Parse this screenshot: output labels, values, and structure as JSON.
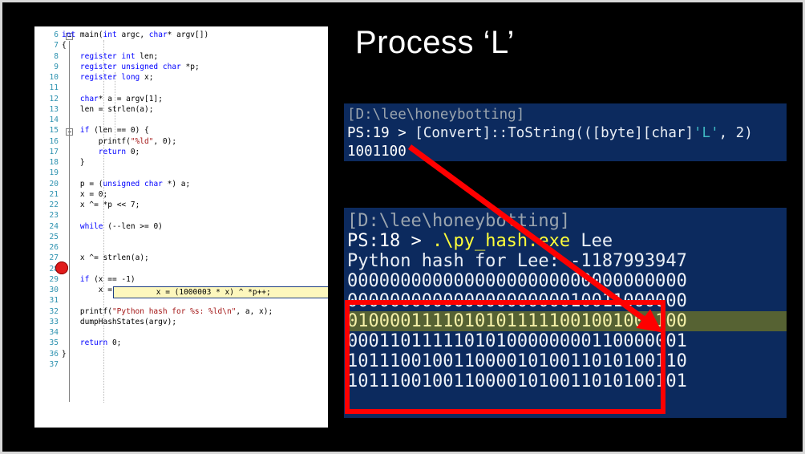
{
  "slide": {
    "title": "Process ‘L’",
    "background_color": "#000000",
    "border_color": "#d8d8d8"
  },
  "code_panel": {
    "language": "c",
    "first_line_number": 6,
    "breakpoint_line": 25,
    "current_line": 25,
    "current_line_text": "        x = (1000003 * x) ^ *p++;",
    "lines": [
      {
        "num": "6",
        "text": "int main(int argc, char* argv[])"
      },
      {
        "num": "7",
        "text": "{"
      },
      {
        "num": "8",
        "text": "    register int len;"
      },
      {
        "num": "9",
        "text": "    register unsigned char *p;"
      },
      {
        "num": "10",
        "text": "    register long x;"
      },
      {
        "num": "11",
        "text": ""
      },
      {
        "num": "12",
        "text": "    char* a = argv[1];"
      },
      {
        "num": "13",
        "text": "    len = strlen(a);"
      },
      {
        "num": "14",
        "text": ""
      },
      {
        "num": "15",
        "text": "    if (len == 0) {"
      },
      {
        "num": "16",
        "text": "        printf(\"%ld\", 0);"
      },
      {
        "num": "17",
        "text": "        return 0;"
      },
      {
        "num": "18",
        "text": "    }"
      },
      {
        "num": "19",
        "text": ""
      },
      {
        "num": "20",
        "text": "    p = (unsigned char *) a;"
      },
      {
        "num": "21",
        "text": "    x = 0;"
      },
      {
        "num": "22",
        "text": "    x ^= *p << 7;"
      },
      {
        "num": "23",
        "text": ""
      },
      {
        "num": "24",
        "text": "    while (--len >= 0)"
      },
      {
        "num": "25",
        "text": ""
      },
      {
        "num": "26",
        "text": ""
      },
      {
        "num": "27",
        "text": "    x ^= strlen(a);"
      },
      {
        "num": "28",
        "text": ""
      },
      {
        "num": "29",
        "text": "    if (x == -1)"
      },
      {
        "num": "30",
        "text": "        x = -2;"
      },
      {
        "num": "31",
        "text": ""
      },
      {
        "num": "32",
        "text": "    printf(\"Python hash for %s: %ld\\n\", a, x);"
      },
      {
        "num": "33",
        "text": "    dumpHashStates(argv);"
      },
      {
        "num": "34",
        "text": ""
      },
      {
        "num": "35",
        "text": "    return 0;"
      },
      {
        "num": "36",
        "text": "}"
      },
      {
        "num": "37",
        "text": ""
      }
    ]
  },
  "terminal_top": {
    "prompt_path": "[D:\\lee\\honeybotting]",
    "prompt_prefix": "PS:19 > ",
    "command_text": "[Convert]::ToString((",
    "command_cast": "[byte][char]",
    "command_literal": "'L'",
    "command_tail": ", 2)",
    "output": "1001100"
  },
  "terminal_bottom": {
    "prompt_path": "[D:\\lee\\honeybotting]",
    "prompt_prefix": "PS:18 > ",
    "command": ".\\py_hash.exe",
    "command_arg": " Lee",
    "result_line": "Python hash for Lee: -1187993947",
    "binary_rows": [
      "00000000000000000000000000000000",
      "00000000000000000000010011000000",
      "01000011110101011111001001001100",
      "00011011111010100000000110000001",
      "10111001001100001010011010100110",
      "10111001001100001010011010100101"
    ],
    "highlight_row_index": 2
  },
  "annotations": {
    "arrow_color": "#ff0000",
    "box_color": "#ff0000",
    "arrow_from": "1001100",
    "arrow_to": "binary-row-2"
  }
}
